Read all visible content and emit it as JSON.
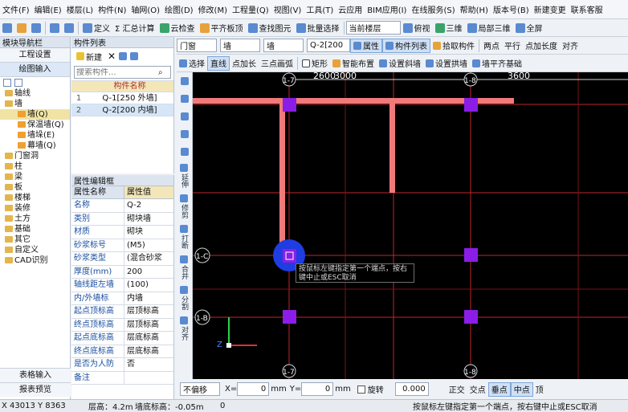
{
  "menu": [
    "文件(F)",
    "编辑(E)",
    "楼层(L)",
    "构件(N)",
    "轴网(O)",
    "绘图(D)",
    "修改(M)",
    "工程量(Q)",
    "视图(V)",
    "工具(T)",
    "云应用",
    "BIM应用(I)",
    "在线服务(S)",
    "帮助(H)",
    "版本号(B)",
    "新建变更",
    "联系客服"
  ],
  "toolbar1": {
    "define": "定义",
    "sum": "Σ 汇总计算",
    "cloud": "云检查",
    "quantity": "平齐板顶",
    "report": "查找图元",
    "select_trace": "批量选择",
    "floor_label": "当前楼层",
    "view": "俯视",
    "three_d": "三维",
    "local_3d": "局部三维",
    "full": "全屏"
  },
  "nav": {
    "title": "模块导航栏",
    "project": "工程设置",
    "draw_input": "绘图输入",
    "table_input": "表格输入",
    "report": "报表预览",
    "tree": [
      {
        "label": "轴线",
        "level": 1
      },
      {
        "label": "墙",
        "level": 1
      },
      {
        "label": "墙(Q)",
        "level": 2,
        "sel": true
      },
      {
        "label": "保温墙(Q)",
        "level": 2
      },
      {
        "label": "墙垛(E)",
        "level": 2
      },
      {
        "label": "幕墙(Q)",
        "level": 2
      },
      {
        "label": "门窗洞",
        "level": 1
      },
      {
        "label": "柱",
        "level": 1
      },
      {
        "label": "梁",
        "level": 1
      },
      {
        "label": "板",
        "level": 1
      },
      {
        "label": "楼梯",
        "level": 1
      },
      {
        "label": "装修",
        "level": 1
      },
      {
        "label": "土方",
        "level": 1
      },
      {
        "label": "基础",
        "level": 1
      },
      {
        "label": "其它",
        "level": 1
      },
      {
        "label": "自定义",
        "level": 1
      },
      {
        "label": "CAD识别",
        "level": 1
      }
    ]
  },
  "complist": {
    "title": "构件列表",
    "new": "新建",
    "search_placeholder": "搜索构件...",
    "col": "构件名称",
    "rows": [
      {
        "n": "1",
        "name": "Q-1[250 外墙]"
      },
      {
        "n": "2",
        "name": "Q-2[200 内墙]"
      }
    ]
  },
  "props": {
    "title": "属性编辑框",
    "col1": "属性名称",
    "col2": "属性值",
    "rows": [
      [
        "名称",
        "Q-2"
      ],
      [
        "类别",
        "砌块墙"
      ],
      [
        "材质",
        "砌块"
      ],
      [
        "砂浆标号",
        "(M5)"
      ],
      [
        "砂浆类型",
        "(混合砂浆"
      ],
      [
        "厚度(mm)",
        "200"
      ],
      [
        "轴线距左墙",
        "(100)"
      ],
      [
        "内/外墙标",
        "内墙"
      ],
      [
        "起点顶标高",
        "层顶标高"
      ],
      [
        "终点顶标高",
        "层顶标高"
      ],
      [
        "起点底标高",
        "层底标高"
      ],
      [
        "终点底标高",
        "层底标高"
      ],
      [
        "是否为人防",
        "否"
      ],
      [
        "备注",
        ""
      ]
    ]
  },
  "toolbar2": {
    "category": "门窗",
    "type": "墙",
    "sub": "墙",
    "comp": "Q-2[200",
    "props": "属性",
    "comp_list": "构件列表",
    "pick": "拾取构件",
    "two_pt": "两点",
    "parallel": "平行",
    "offset": "点加长度",
    "align": "对齐"
  },
  "toolbar3": {
    "select": "选择",
    "line": "直线",
    "add_len": "点加长",
    "three_arc": "三点画弧",
    "rect": "矩形",
    "smart": "智能布置",
    "set_slope": "设置斜墙",
    "set_arch": "设置拱墙",
    "fix_side": "墙平齐基础"
  },
  "vtools": [
    "延伸",
    "修剪",
    "打断",
    "合并",
    "分割",
    "对齐"
  ],
  "cad": {
    "dim1": "2600",
    "dim2": "3000",
    "dim3": "3600",
    "axes": [
      "1-7",
      "1-8",
      "1-C",
      "1-B"
    ],
    "tooltip": "按鼠标左键指定第一个端点，按右键中止或ESC取消"
  },
  "inbar": {
    "mode": "不偏移",
    "x_label": "X=",
    "x_val": "0",
    "unit": "mm",
    "y_label": "Y=",
    "y_val": "0",
    "rotate": "旋转",
    "angle": "0.000",
    "ortho": "正交",
    "intersect": "交点",
    "midpoint": "垂点",
    "mid": "中点",
    "top": "顶"
  },
  "status": {
    "coord": "X 43013 Y 8363",
    "floor_h": "层高：4.2m",
    "base_h": "墙底标高：-0.05m",
    "zero": "0",
    "msg": "按鼠标左键指定第一个端点，按右键中止或ESC取消"
  }
}
